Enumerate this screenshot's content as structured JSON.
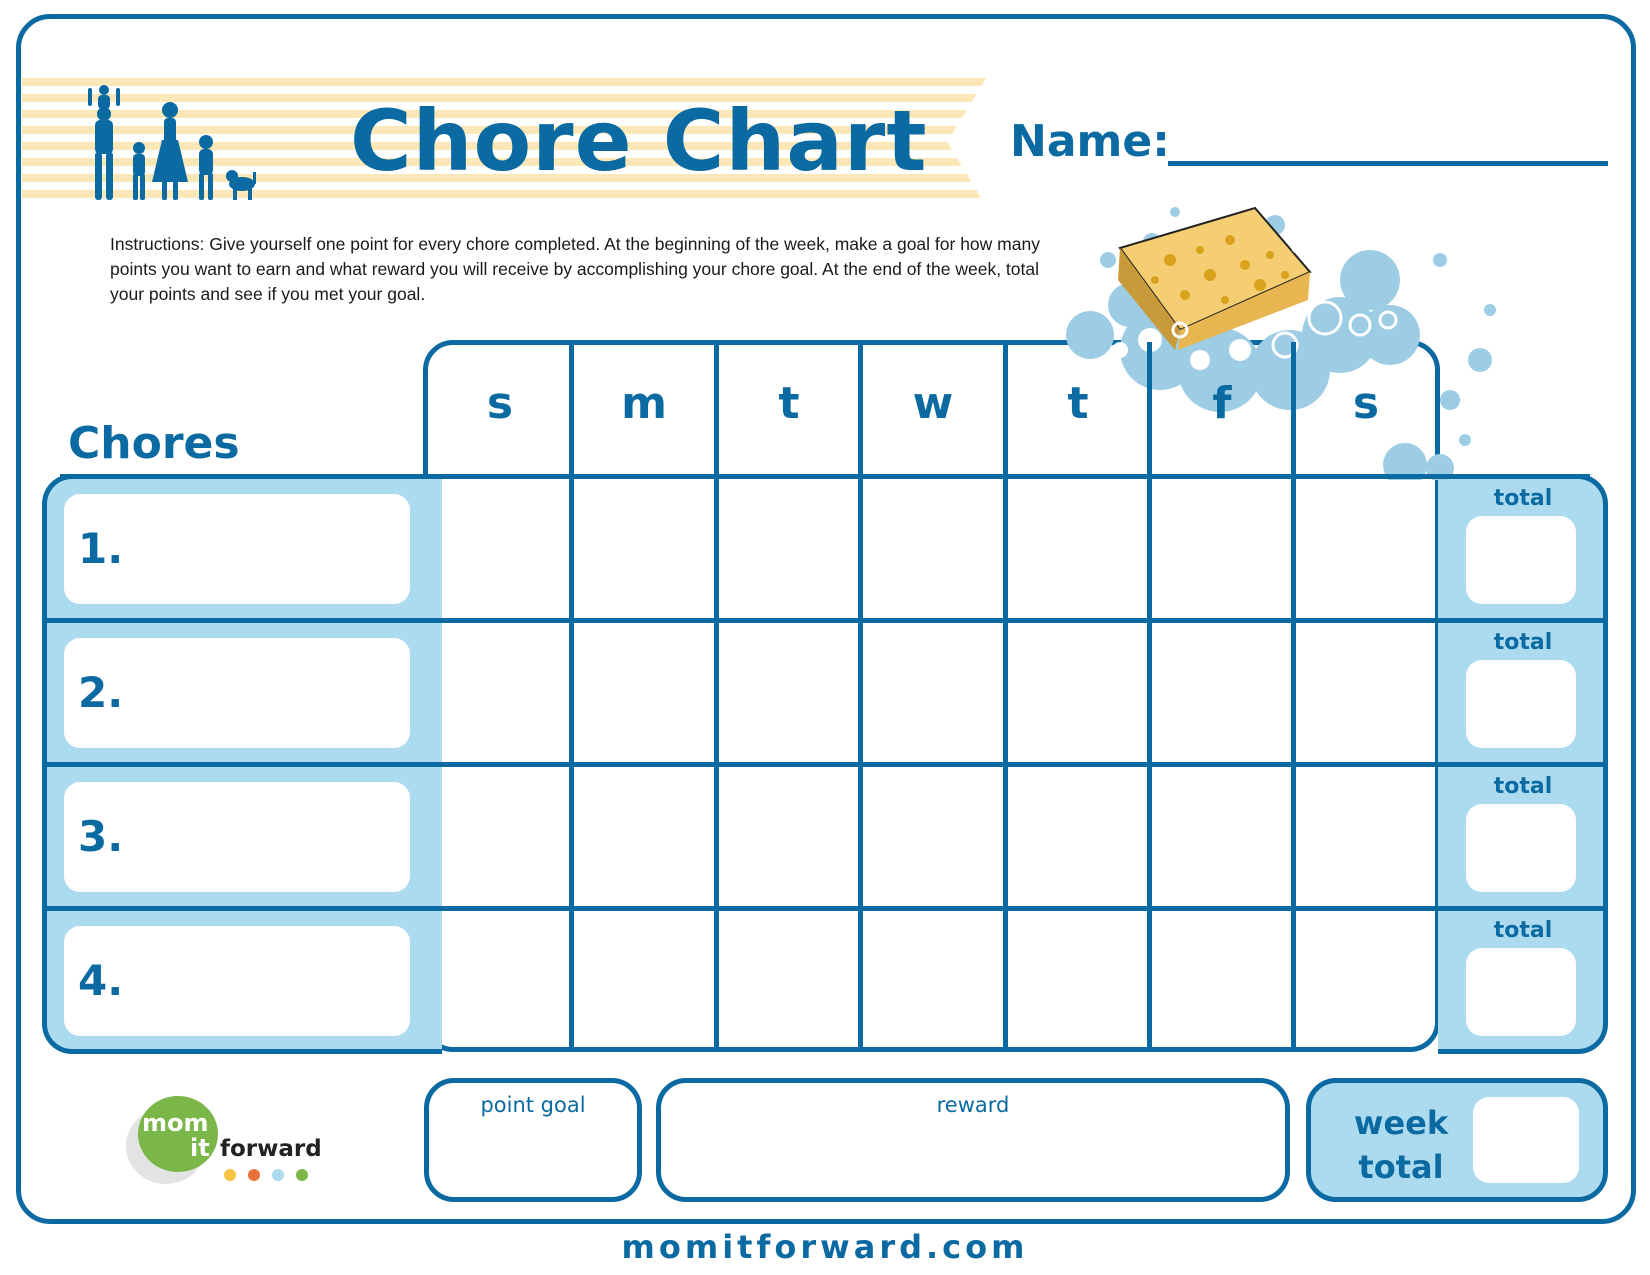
{
  "header": {
    "title": "Chore Chart",
    "name_label": "Name:",
    "name_value": ""
  },
  "instructions": "Instructions: Give yourself one point for every chore completed. At the beginning of the week, make a goal for how many points you want to earn and what reward you will receive by accomplishing your chore goal. At the end of the week, total your points and see if you met your goal.",
  "chart": {
    "chores_label": "Chores",
    "days": [
      "s",
      "m",
      "t",
      "w",
      "t",
      "f",
      "s"
    ],
    "rows": [
      {
        "number": "1.",
        "chore": "",
        "total_label": "total",
        "total": ""
      },
      {
        "number": "2.",
        "chore": "",
        "total_label": "total",
        "total": ""
      },
      {
        "number": "3.",
        "chore": "",
        "total_label": "total",
        "total": ""
      },
      {
        "number": "4.",
        "chore": "",
        "total_label": "total",
        "total": ""
      }
    ]
  },
  "footer": {
    "point_goal_label": "point goal",
    "reward_label": "reward",
    "week_total_label": "week total",
    "logo": {
      "line1": "mom",
      "line2": "it",
      "line3": "forward",
      "dot_colors": [
        "#f6c342",
        "#e8733a",
        "#acdaee",
        "#7ab648"
      ]
    },
    "url": "momitforward.com"
  },
  "colors": {
    "primary_blue": "#0a6aa1",
    "light_blue": "#acdaee",
    "banner_stripe": "#fbe8b6",
    "logo_green": "#7ab648",
    "sponge_yellow": "#f5cd72"
  }
}
